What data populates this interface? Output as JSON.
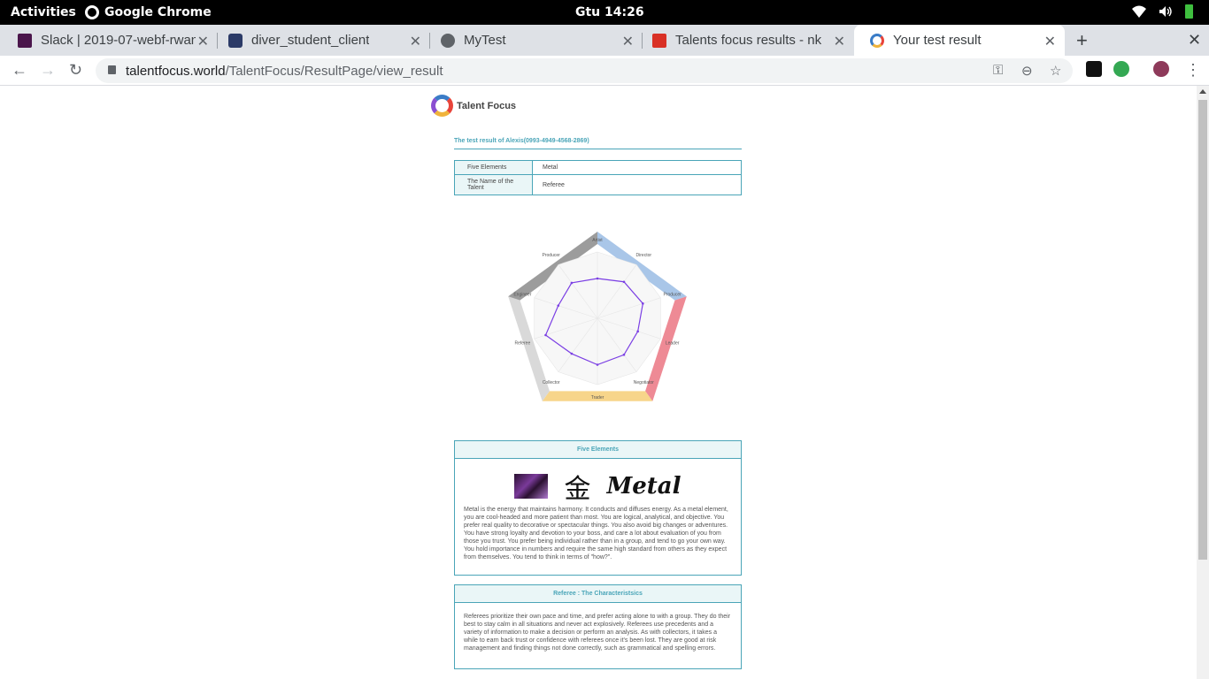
{
  "system_bar": {
    "activities": "Activities",
    "app_name": "Google Chrome",
    "clock": "Gtu 14:26"
  },
  "tabs": [
    {
      "title": "Slack | 2019-07-webf-rwan",
      "favicon_color": "#4a154b"
    },
    {
      "title": "diver_student_client",
      "favicon_color": "#2b3a67"
    },
    {
      "title": "MyTest",
      "favicon_color": "#5f6368"
    },
    {
      "title": "Talents focus results - nk",
      "favicon_color": "#d93025"
    },
    {
      "title": "Your test result",
      "favicon_color": "#3a7cc7"
    }
  ],
  "address_bar": {
    "domain": "talentfocus.world",
    "path": "/TalentFocus/ResultPage/view_result"
  },
  "page": {
    "logo_text": "Talent Focus",
    "result_title": "The test result of Alexis(0993-4949-4568-2869)",
    "table": [
      {
        "key": "Five Elements",
        "value": "Metal"
      },
      {
        "key": "The Name of the Talent",
        "value": "Referee"
      }
    ],
    "five_elements_box": {
      "header": "Five Elements",
      "kanji": "金",
      "word": "Metal",
      "text": "Metal is the energy that maintains harmony. It conducts and diffuses energy. As a metal element, you are cool-headed and more patient than most. You are logical, analytical, and objective. You prefer real quality to decorative or spectacular things. You also avoid big changes or adventures. You have strong loyalty and devotion to your boss, and care a lot about evaluation of you from those you trust. You prefer being individual rather than in a group, and tend to go your own way. You hold importance in numbers and require the same high standard from others as they expect from themselves. You tend to think in terms of \"how?\"."
    },
    "characteristics_box": {
      "header": "Referee : The Characteristsics",
      "text": "Referees prioritize their own pace and time, and prefer acting alone to with a group. They do their best to stay calm in all situations and never act explosively. Referees use precedents and a variety of information to make a decision or perform an analysis. As with collectors, it takes a while to earn back trust or confidence with referees once it's been lost. They are good at risk management and finding things not done correctly, such as grammatical and spelling errors."
    }
  },
  "chart_data": {
    "type": "radar",
    "title": "",
    "categories": [
      "Artist",
      "Director",
      "Producer",
      "Leader",
      "Negotiator",
      "Trader",
      "Collector",
      "Referee",
      "Engineer",
      "Producer"
    ],
    "series": [
      {
        "values": [
          60,
          68,
          72,
          64,
          68,
          70,
          66,
          82,
          62,
          66
        ]
      }
    ],
    "rlim": [
      0,
      100
    ],
    "colors": {
      "series": "#7b3fe4",
      "grid": "#e6e6e6"
    }
  }
}
